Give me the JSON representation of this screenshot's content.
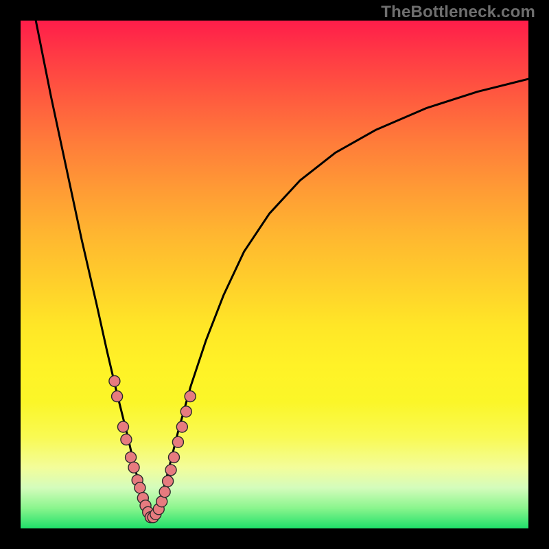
{
  "watermark": {
    "text": "TheBottleneck.com"
  },
  "chart_data": {
    "type": "line",
    "title": "",
    "xlabel": "",
    "ylabel": "",
    "xlim": [
      0,
      100
    ],
    "ylim": [
      0,
      100
    ],
    "optimum_x": 25.7,
    "gradient_description": "red (top) → orange → yellow → pale → green (bottom)",
    "series": [
      {
        "name": "bottleneck-curve",
        "x": [
          0,
          3,
          6,
          9,
          12,
          15,
          17,
          19,
          21,
          22.5,
          24,
          25.7,
          27.5,
          29,
          31,
          33.5,
          36.5,
          40,
          44,
          49,
          55,
          62,
          70,
          80,
          90,
          100
        ],
        "y": [
          115,
          100,
          85,
          71,
          57,
          44,
          35,
          26.5,
          18.5,
          12,
          6,
          1.5,
          5.5,
          11,
          19,
          28,
          37,
          46,
          54.5,
          62,
          68.5,
          74,
          78.5,
          82.8,
          86,
          88.5
        ]
      }
    ],
    "points_cluster": {
      "name": "sample-points",
      "color": "#e77b7f",
      "stroke": "#2b2b2b",
      "radius": 8,
      "coords": [
        [
          18.5,
          29
        ],
        [
          19.0,
          26
        ],
        [
          20.2,
          20
        ],
        [
          20.8,
          17.5
        ],
        [
          21.7,
          14
        ],
        [
          22.3,
          12
        ],
        [
          23.0,
          9.5
        ],
        [
          23.5,
          8
        ],
        [
          24.1,
          6
        ],
        [
          24.6,
          4.5
        ],
        [
          25.1,
          3.2
        ],
        [
          25.6,
          2.2
        ],
        [
          26.1,
          2.2
        ],
        [
          26.6,
          2.8
        ],
        [
          27.2,
          3.8
        ],
        [
          27.8,
          5.3
        ],
        [
          28.4,
          7.2
        ],
        [
          29.0,
          9.3
        ],
        [
          29.6,
          11.5
        ],
        [
          30.2,
          14
        ],
        [
          31.0,
          17
        ],
        [
          31.8,
          20
        ],
        [
          32.6,
          23
        ],
        [
          33.4,
          26
        ]
      ]
    }
  }
}
